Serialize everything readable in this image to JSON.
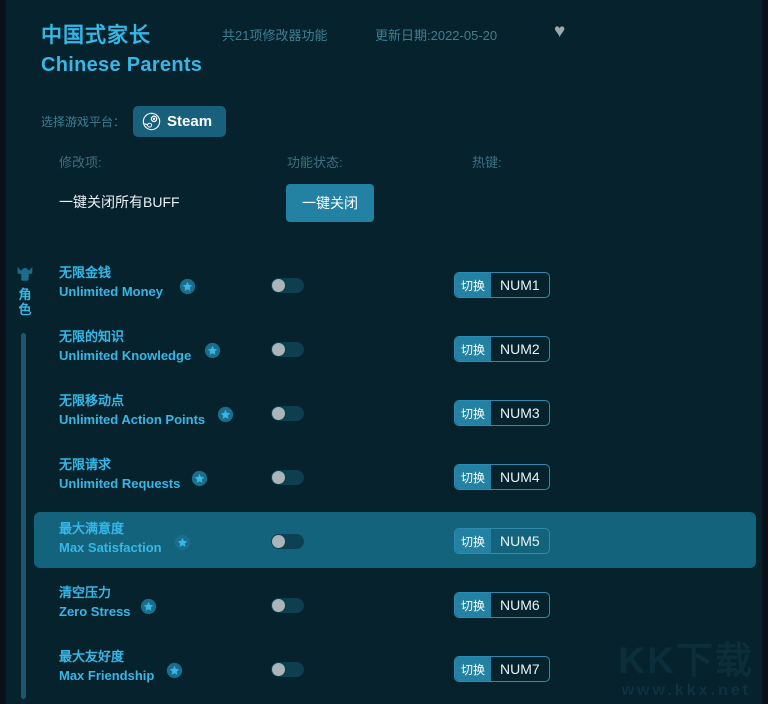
{
  "header": {
    "title_cn": "中国式家长",
    "title_en": "Chinese Parents",
    "feature_count": "共21项修改器功能",
    "update_date": "更新日期:2022-05-20",
    "favorite_icon": "♥",
    "favorite_icon_name": "heart-icon"
  },
  "platform": {
    "label": "选择游戏平台：",
    "selected": "Steam",
    "icon_name": "steam-icon"
  },
  "columns": {
    "item": "修改项:",
    "status": "功能状态:",
    "hotkey": "热键:"
  },
  "master": {
    "label": "一键关闭所有BUFF",
    "button": "一键关闭"
  },
  "sidebar": {
    "categories": [
      {
        "label": "角色",
        "icon_name": "character-icon",
        "active": true
      }
    ]
  },
  "cheats": [
    {
      "name_cn": "无限金钱",
      "name_en": "Unlimited Money",
      "star": true,
      "enabled": false,
      "hotkey_action": "切换",
      "hotkey_key": "NUM1",
      "selected": false
    },
    {
      "name_cn": "无限的知识",
      "name_en": "Unlimited Knowledge",
      "star": true,
      "enabled": false,
      "hotkey_action": "切换",
      "hotkey_key": "NUM2",
      "selected": false
    },
    {
      "name_cn": "无限移动点",
      "name_en": "Unlimited Action Points",
      "star": true,
      "enabled": false,
      "hotkey_action": "切换",
      "hotkey_key": "NUM3",
      "selected": false
    },
    {
      "name_cn": "无限请求",
      "name_en": "Unlimited Requests",
      "star": true,
      "enabled": false,
      "hotkey_action": "切换",
      "hotkey_key": "NUM4",
      "selected": false
    },
    {
      "name_cn": "最大满意度",
      "name_en": "Max Satisfaction",
      "star": true,
      "enabled": false,
      "hotkey_action": "切换",
      "hotkey_key": "NUM5",
      "selected": true
    },
    {
      "name_cn": "清空压力",
      "name_en": "Zero Stress",
      "star": true,
      "enabled": false,
      "hotkey_action": "切换",
      "hotkey_key": "NUM6",
      "selected": false
    },
    {
      "name_cn": "最大友好度",
      "name_en": "Max Friendship",
      "star": true,
      "enabled": false,
      "hotkey_action": "切换",
      "hotkey_key": "NUM7",
      "selected": false
    }
  ],
  "watermark": {
    "main": "KK下载",
    "sub": "www.kkx.net"
  },
  "colors": {
    "background": "#06222c",
    "accent": "#35b7e8",
    "button": "#2382a4",
    "selected_row": "#14637d",
    "muted_text": "#3f7e93"
  }
}
